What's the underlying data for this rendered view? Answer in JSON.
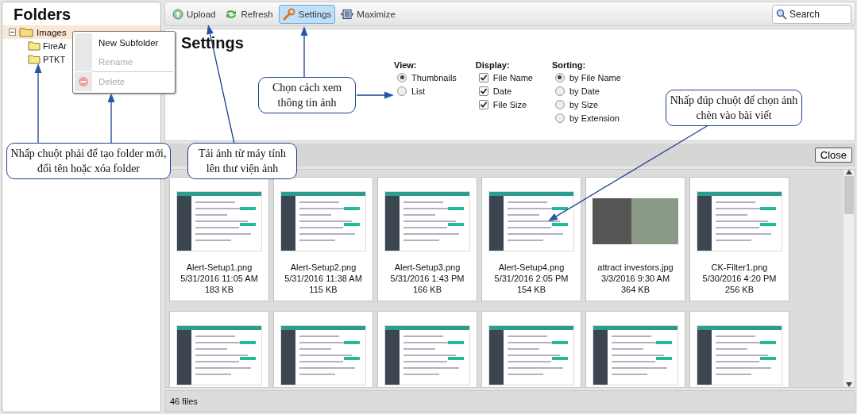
{
  "sidebar": {
    "title": "Folders",
    "tree": [
      {
        "label": "Images",
        "expanded": true,
        "selected": true,
        "children": [
          {
            "label": "FireAr",
            "selected": false
          },
          {
            "label": "PTKT",
            "selected": false
          }
        ]
      }
    ]
  },
  "context_menu": {
    "items": [
      {
        "label": "New Subfolder",
        "kind": "action",
        "disabled": false
      },
      {
        "label": "Rename",
        "kind": "action",
        "disabled": true
      },
      {
        "label": "Delete",
        "kind": "delete",
        "disabled": true
      }
    ]
  },
  "toolbar": {
    "buttons": [
      {
        "label": "Upload",
        "kind": "upload",
        "selected": false
      },
      {
        "label": "Refresh",
        "kind": "refresh",
        "selected": false
      },
      {
        "label": "Settings",
        "kind": "settings",
        "selected": true
      },
      {
        "label": "Maximize",
        "kind": "maximize",
        "selected": false
      }
    ],
    "search": {
      "placeholder": "Search"
    }
  },
  "settings": {
    "title": "Settings",
    "groups": [
      {
        "label": "View:",
        "kind": "radio",
        "options": [
          {
            "label": "Thumbnails",
            "selected": true
          },
          {
            "label": "List",
            "selected": false
          }
        ]
      },
      {
        "label": "Display:",
        "kind": "checkbox",
        "options": [
          {
            "label": "File Name",
            "checked": true
          },
          {
            "label": "Date",
            "checked": true
          },
          {
            "label": "File Size",
            "checked": true
          }
        ]
      },
      {
        "label": "Sorting:",
        "kind": "radio",
        "options": [
          {
            "label": "by File Name",
            "selected": true
          },
          {
            "label": "by Date",
            "selected": false
          },
          {
            "label": "by Size",
            "selected": false
          },
          {
            "label": "by Extension",
            "selected": false
          }
        ]
      }
    ],
    "close_button": "Close"
  },
  "files": [
    {
      "kind": "screenshot",
      "name": "Alert-Setup1.png",
      "date": "5/31/2016 11:05 AM",
      "size": "183 KB"
    },
    {
      "kind": "screenshot",
      "name": "Alert-Setup2.png",
      "date": "5/31/2016 11:38 AM",
      "size": "115 KB"
    },
    {
      "kind": "screenshot",
      "name": "Alert-Setup3.png",
      "date": "5/31/2016 1:43 PM",
      "size": "166 KB"
    },
    {
      "kind": "screenshot",
      "name": "Alert-Setup4.png",
      "date": "5/31/2016 2:05 PM",
      "size": "154 KB"
    },
    {
      "kind": "photo",
      "name": "attract investors.jpg",
      "date": "3/3/2016 9:30 AM",
      "size": "364 KB"
    },
    {
      "kind": "screenshot",
      "name": "CK-Filter1.png",
      "date": "5/30/2016 4:20 PM",
      "size": "256 KB"
    },
    {
      "kind": "screenshot"
    },
    {
      "kind": "screenshot"
    },
    {
      "kind": "screenshot"
    },
    {
      "kind": "screenshot"
    },
    {
      "kind": "screenshot"
    },
    {
      "kind": "screenshot"
    }
  ],
  "status_bar": "46 files",
  "callouts": [
    {
      "text": "Nhấp chuột phải để tạo folder mới, đổi tên hoặc xóa folder"
    },
    {
      "text": "Tải ảnh từ máy tính lên thư viện ảnh"
    },
    {
      "text": "Chọn cách xem thông tin ảnh"
    },
    {
      "text": "Nhấp đúp chuột để chọn ảnh chèn vào bài viết"
    }
  ]
}
